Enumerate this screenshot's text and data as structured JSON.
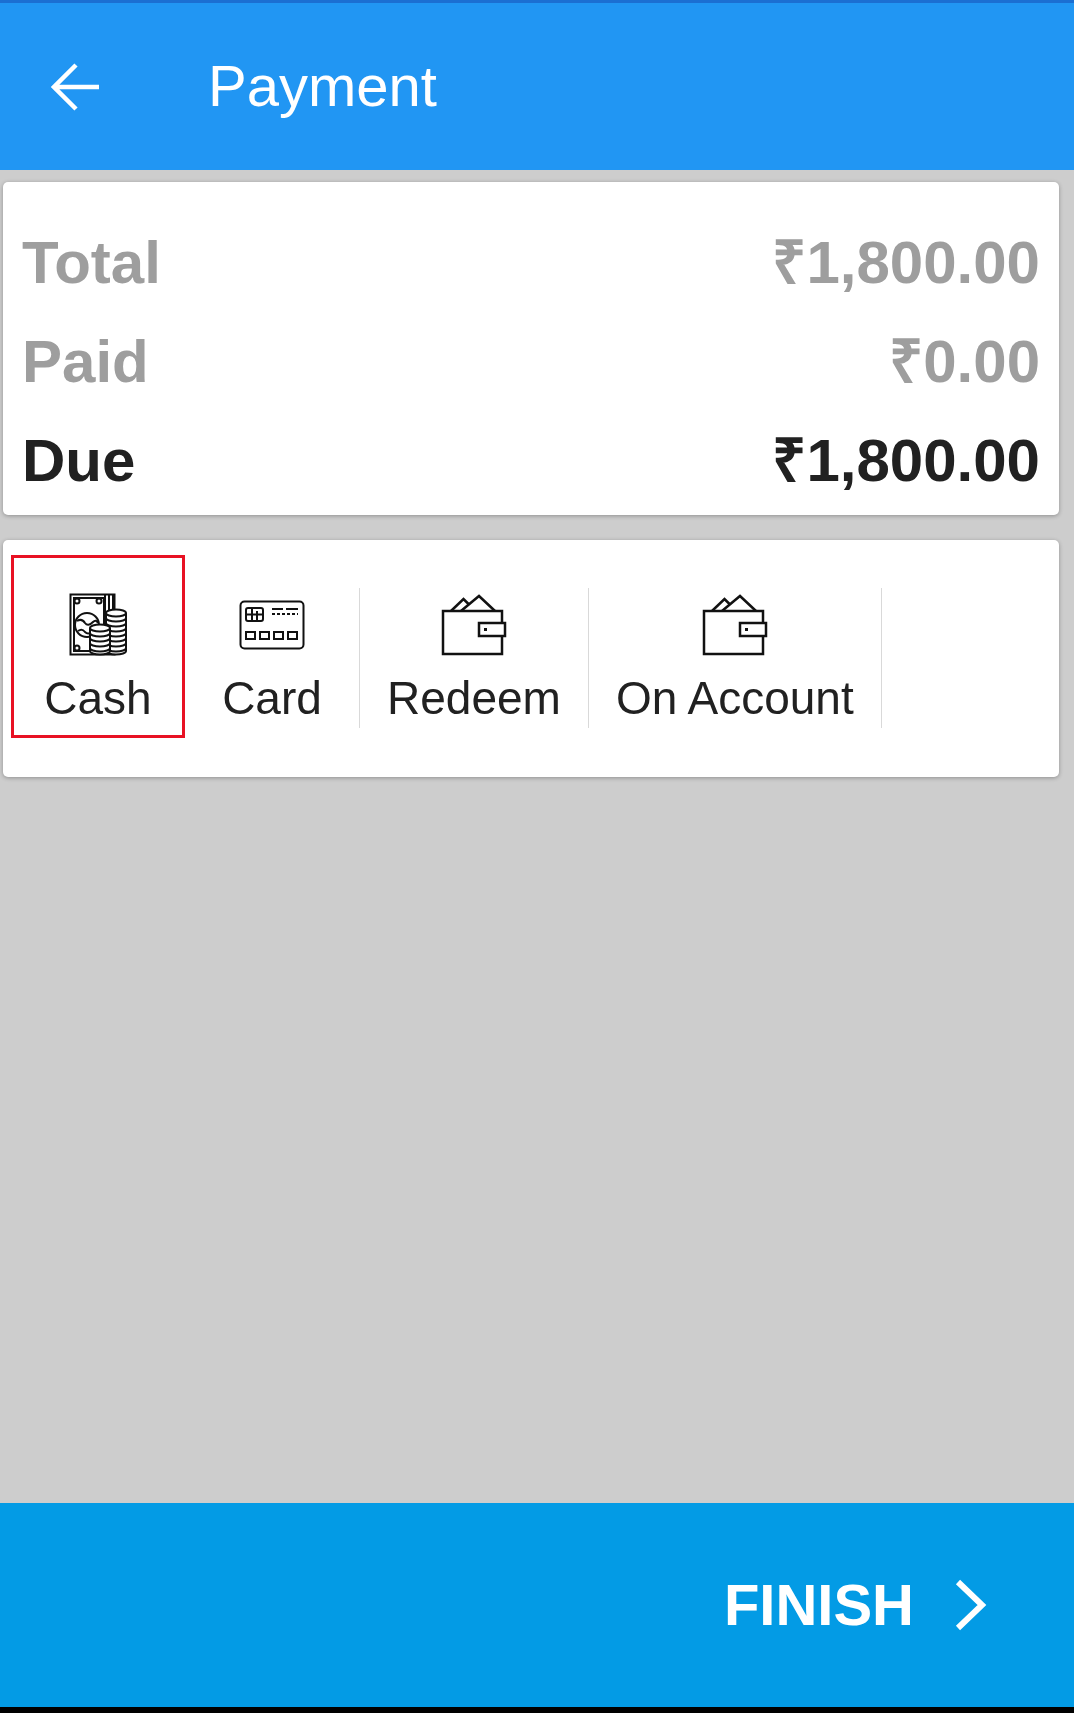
{
  "header": {
    "title": "Payment"
  },
  "summary": [
    {
      "label": "Total",
      "amount": "₹1,800.00",
      "kind": "muted"
    },
    {
      "label": "Paid",
      "amount": "₹0.00",
      "kind": "muted"
    },
    {
      "label": "Due",
      "amount": "₹1,800.00",
      "kind": "emphasis"
    }
  ],
  "payment_methods": [
    {
      "label": "Cash",
      "kind": "cash",
      "selected": true
    },
    {
      "label": "Card",
      "kind": "card",
      "selected": false
    },
    {
      "label": "Redeem",
      "kind": "wallet",
      "selected": false
    },
    {
      "label": "On Account",
      "kind": "wallet",
      "selected": false
    }
  ],
  "finish_button": {
    "label": "FINISH"
  }
}
